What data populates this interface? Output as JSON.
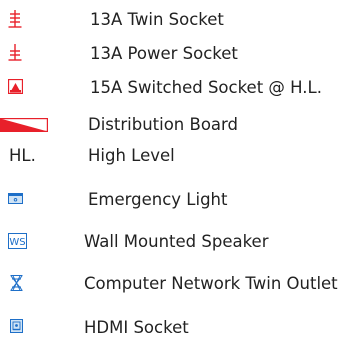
{
  "legend": {
    "items": [
      {
        "symbol": "twin-socket-icon",
        "label": "13A Twin Socket"
      },
      {
        "symbol": "power-socket-icon",
        "label": "13A Power Socket"
      },
      {
        "symbol": "switched-socket-icon",
        "label": "15A Switched Socket @ H.L."
      },
      {
        "symbol": "distribution-board-icon",
        "label": "Distribution Board"
      },
      {
        "symbol_text": "HL.",
        "label": "High Level"
      },
      {
        "symbol": "emergency-light-icon",
        "label": "Emergency Light"
      },
      {
        "symbol_text": "WS",
        "label": "Wall Mounted Speaker"
      },
      {
        "symbol": "network-twin-outlet-icon",
        "label": "Computer Network Twin Outlet"
      },
      {
        "symbol": "hdmi-socket-icon",
        "label": "HDMI Socket"
      }
    ]
  },
  "colors": {
    "symbol_red": "#e8202a",
    "symbol_blue": "#1e6fc8",
    "symbol_light_blue": "#cfe3f5",
    "text": "#222222"
  }
}
